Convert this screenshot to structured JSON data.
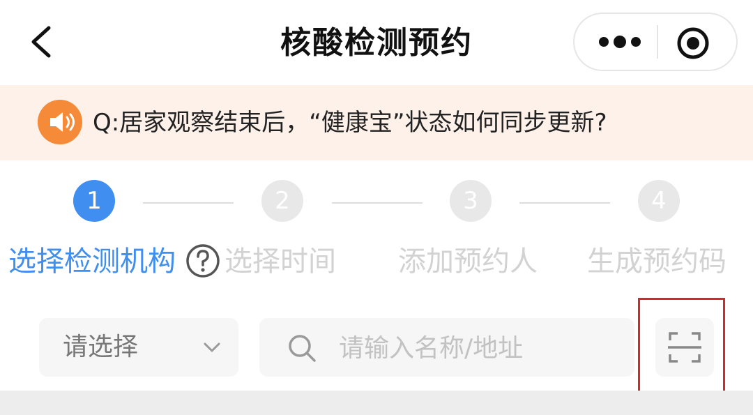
{
  "nav": {
    "title": "核酸检测预约",
    "back_icon": "chevron-left-icon",
    "more_icon": "more-dots-icon",
    "close_icon": "target-close-icon"
  },
  "notice": {
    "icon": "speaker-icon",
    "text": "Q:居家观察结束后，“健康宝”状态如何同步更新?"
  },
  "steps": {
    "items": [
      {
        "number": "1",
        "label": "选择检测机构",
        "state": "active"
      },
      {
        "number": "2",
        "label": "选择时间",
        "state": "inactive"
      },
      {
        "number": "3",
        "label": "添加预约人",
        "state": "inactive"
      },
      {
        "number": "4",
        "label": "生成预约码",
        "state": "inactive"
      }
    ],
    "help_icon": "question-circle-icon"
  },
  "filters": {
    "select_label": "请选择",
    "search_placeholder": "请输入名称/地址",
    "scan_icon": "scan-icon"
  },
  "colors": {
    "accent": "#3f8ef0",
    "notice_bg": "#fdf1ea",
    "notice_icon": "#f58a38",
    "highlight": "#d02b2b"
  }
}
